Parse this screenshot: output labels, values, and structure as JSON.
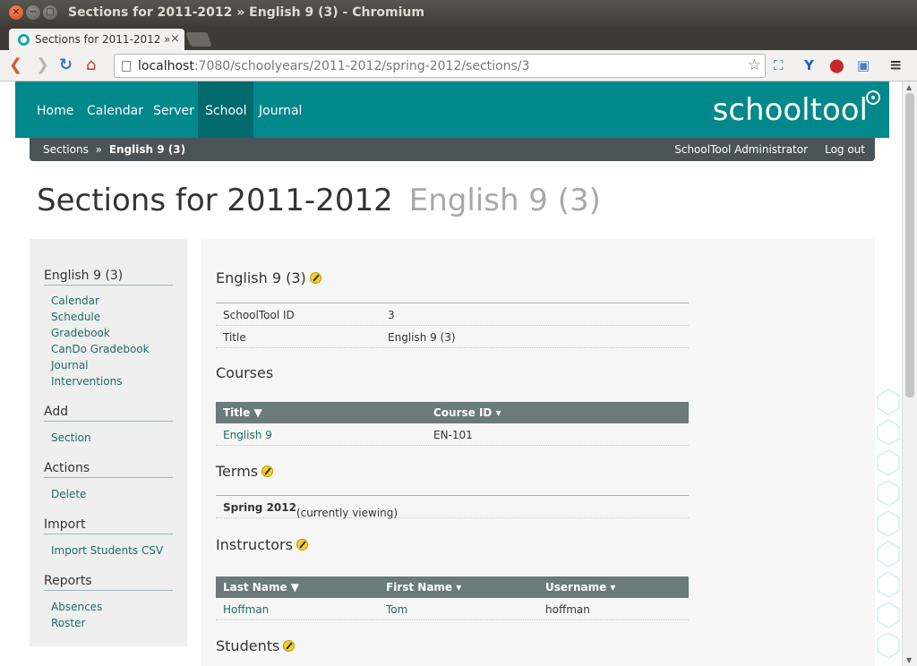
{
  "window": {
    "title": "Sections for 2011-2012 » English 9 (3) - Chromium",
    "close_glyph": "×",
    "min_glyph": "−",
    "max_glyph": "□"
  },
  "browser": {
    "tab_label": "Sections for 2011-2012 »",
    "tab_close": "×",
    "url_host": "localhost",
    "url_rest": ":7080/schoolyears/2011-2012/spring-2012/sections/3",
    "back_glyph": "❮",
    "forward_glyph": "❯",
    "reload_glyph": "↻",
    "home_glyph": "⌂",
    "star_glyph": "☆",
    "ext_icons": [
      "⛶",
      "Y",
      "⬤",
      "▣",
      "≡"
    ]
  },
  "nav": {
    "items": [
      "Home",
      "Calendar",
      "Server",
      "School",
      "Journal"
    ],
    "active": "School",
    "brand": "schooltool"
  },
  "breadcrumb": {
    "parent": "Sections",
    "separator": "»",
    "current": "English 9 (3)",
    "user": "SchoolTool Administrator",
    "logout": "Log out"
  },
  "page": {
    "title": "Sections for 2011-2012",
    "subtitle": "English 9 (3)"
  },
  "sidebar": {
    "section_title": "English 9 (3)",
    "section_links": [
      "Calendar",
      "Schedule",
      "Gradebook",
      "CanDo Gradebook",
      "Journal",
      "Interventions"
    ],
    "add_title": "Add",
    "add_links": [
      "Section"
    ],
    "actions_title": "Actions",
    "actions_links": [
      "Delete"
    ],
    "import_title": "Import",
    "import_links": [
      "Import Students CSV"
    ],
    "reports_title": "Reports",
    "reports_links": [
      "Absences",
      "Roster"
    ]
  },
  "content": {
    "heading": "English 9 (3)",
    "details": [
      {
        "label": "SchoolTool ID",
        "value": "3"
      },
      {
        "label": "Title",
        "value": "English 9 (3)"
      }
    ],
    "courses": {
      "heading": "Courses",
      "columns": [
        "Title ▼",
        "Course ID ▾"
      ],
      "rows": [
        [
          "English 9",
          "EN-101"
        ]
      ]
    },
    "terms": {
      "heading": "Terms",
      "term": "Spring 2012",
      "note": "(currently viewing)"
    },
    "instructors": {
      "heading": "Instructors",
      "columns": [
        "Last Name ▼",
        "First Name ▾",
        "Username ▾"
      ],
      "rows": [
        [
          "Hoffman",
          "Tom",
          "hoffman"
        ]
      ]
    },
    "students": {
      "heading": "Students"
    }
  },
  "colors": {
    "nav_bg": "#00888b",
    "nav_active": "#006a6c",
    "crumb_bg": "#4a5458",
    "grid_header": "#6b7a7b",
    "link": "#1e6b6d"
  }
}
